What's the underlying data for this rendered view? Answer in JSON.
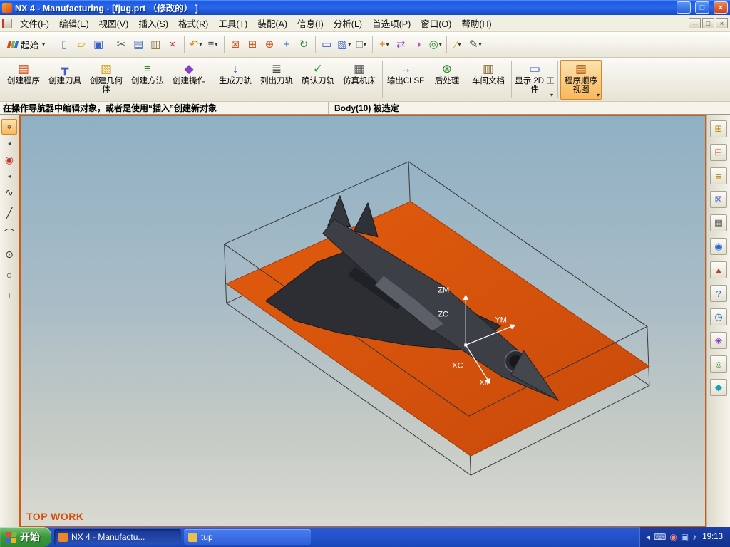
{
  "titlebar": {
    "title": "NX 4 - Manufacturing - [fjug.prt （修改的） ]",
    "min_glyph": "_",
    "restore_glyph": "□",
    "close_glyph": "×"
  },
  "menubar": {
    "items": [
      "文件(F)",
      "编辑(E)",
      "视图(V)",
      "插入(S)",
      "格式(R)",
      "工具(T)",
      "装配(A)",
      "信息(I)",
      "分析(L)",
      "首选项(P)",
      "窗口(O)",
      "帮助(H)"
    ],
    "mdi": {
      "min": "—",
      "restore": "□",
      "close": "×"
    }
  },
  "standard_toolbar": {
    "start_button": {
      "label": "起始",
      "caret": "▾"
    },
    "icons": [
      {
        "name": "new-file-icon",
        "g": "▯",
        "c": "#6b86b8"
      },
      {
        "name": "open-folder-icon",
        "g": "▱",
        "c": "#d9a520"
      },
      {
        "name": "save-icon",
        "g": "▣",
        "c": "#3a5fcd"
      },
      {
        "type": "sep"
      },
      {
        "name": "cut-icon",
        "g": "✂",
        "c": "#555555"
      },
      {
        "name": "copy-icon",
        "g": "▤",
        "c": "#4a72c4"
      },
      {
        "name": "paste-icon",
        "g": "▥",
        "c": "#8a6d3b"
      },
      {
        "name": "delete-icon",
        "g": "×",
        "c": "#cc2222"
      },
      {
        "type": "sep"
      },
      {
        "name": "undo-icon",
        "g": "↶",
        "c": "#e07b00",
        "caret": "▾"
      },
      {
        "name": "repeat-command-icon",
        "g": "≡",
        "c": "#555555",
        "caret": "▾"
      },
      {
        "type": "sep"
      },
      {
        "name": "fit-view-icon",
        "g": "⊠",
        "c": "#d9531e"
      },
      {
        "name": "zoom-window-icon",
        "g": "⊞",
        "c": "#d9531e"
      },
      {
        "name": "zoom-icon",
        "g": "⊕",
        "c": "#d9531e"
      },
      {
        "name": "pan-icon",
        "g": "+",
        "c": "#3a5fcd"
      },
      {
        "name": "rotate-view-icon",
        "g": "↻",
        "c": "#2e8b2e"
      },
      {
        "type": "sep"
      },
      {
        "name": "snapshot-icon",
        "g": "▭",
        "c": "#3a5fcd"
      },
      {
        "name": "shaded-view-icon",
        "g": "▧",
        "c": "#3a5fcd",
        "caret": "▾"
      },
      {
        "name": "render-style-icon",
        "g": "□",
        "c": "#707070",
        "caret": "▾"
      },
      {
        "type": "sep"
      },
      {
        "name": "wcs-dynamics-icon",
        "g": "+",
        "c": "#e07b00",
        "caret": "▾"
      },
      {
        "name": "transform-icon",
        "g": "⇄",
        "c": "#8a40c8"
      },
      {
        "name": "edit-object-display-icon",
        "g": "◑",
        "c": "#b05ac4"
      },
      {
        "name": "show-hide-icon",
        "g": "◎",
        "c": "#2e8b2e",
        "caret": "▾"
      },
      {
        "type": "sep"
      },
      {
        "name": "measure-distance-icon",
        "g": "∕",
        "c": "#d9a520",
        "caret": "▾"
      },
      {
        "name": "annotation-pencil-icon",
        "g": "✎",
        "c": "#555555",
        "caret": "▾"
      }
    ]
  },
  "mfg_toolbar": {
    "buttons": [
      {
        "name": "create-program-button",
        "label": "创建程序",
        "g": "▤",
        "c": "#d9531e"
      },
      {
        "name": "create-tool-button",
        "label": "创建刀具",
        "g": "┳",
        "c": "#3a5fcd"
      },
      {
        "name": "create-geometry-button",
        "label": "创建几何体",
        "g": "▧",
        "c": "#d9a41e"
      },
      {
        "name": "create-method-button",
        "label": "创建方法",
        "g": "≡",
        "c": "#2e8b2e"
      },
      {
        "name": "create-operation-button",
        "label": "创建操作",
        "g": "◆",
        "c": "#8a40c8"
      },
      {
        "type": "sep"
      },
      {
        "name": "generate-toolpath-button",
        "label": "生成刀轨",
        "g": "↓",
        "c": "#2255cc"
      },
      {
        "name": "list-toolpath-button",
        "label": "列出刀轨",
        "g": "≣",
        "c": "#444444"
      },
      {
        "name": "verify-toolpath-button",
        "label": "确认刀轨",
        "g": "✓",
        "c": "#22a022"
      },
      {
        "name": "simulate-machine-button",
        "label": "仿真机床",
        "g": "▦",
        "c": "#666666"
      },
      {
        "type": "sep"
      },
      {
        "name": "output-clsf-button",
        "label": "输出CLSF",
        "g": "→",
        "c": "#2255cc"
      },
      {
        "name": "postprocess-button",
        "label": "后处理",
        "g": "⊛",
        "c": "#2e8b2e"
      },
      {
        "name": "shop-documents-button",
        "label": "车间文档",
        "g": "▥",
        "c": "#8a6d3b"
      },
      {
        "type": "sep"
      },
      {
        "name": "show-2d-workpiece-button",
        "label": "显示 2D 工件",
        "g": "▭",
        "c": "#2255cc",
        "caret": "▾"
      },
      {
        "type": "sep"
      },
      {
        "name": "program-order-view-button",
        "label": "程序顺序视图",
        "g": "▤",
        "c": "#b35a10",
        "caret": "▾",
        "active": true
      }
    ]
  },
  "prompt": {
    "message": "在操作导航器中编辑对象，或者是使用“插入”创建新对象",
    "status": "Body(10) 被选定"
  },
  "left_rail": {
    "icons": [
      {
        "name": "snap-point-icon",
        "g": "⌖",
        "c": "#222222",
        "active": true
      },
      {
        "name": "expand-chevron-icon",
        "g": "◂",
        "c": "#444444",
        "cls": "small"
      },
      {
        "name": "feature-tool-icon",
        "g": "◉",
        "c": "#c0392b"
      },
      {
        "name": "expand-chevron-icon",
        "g": "◂",
        "c": "#444444",
        "cls": "small"
      },
      {
        "name": "spline-icon",
        "g": "∿",
        "c": "#333333"
      },
      {
        "name": "line-icon",
        "g": "╱",
        "c": "#333333"
      },
      {
        "name": "arc-icon",
        "g": "⌒",
        "c": "#333333"
      },
      {
        "name": "circle-center-icon",
        "g": "⊙",
        "c": "#333333"
      },
      {
        "name": "circle-icon",
        "g": "○",
        "c": "#333333"
      },
      {
        "name": "point-icon",
        "g": "+",
        "c": "#333333"
      }
    ]
  },
  "right_rail": {
    "icons": [
      {
        "name": "assembly-navigator-icon",
        "g": "⊞",
        "c": "#b8860b"
      },
      {
        "name": "constraint-navigator-icon",
        "g": "⊟",
        "c": "#c0392b"
      },
      {
        "name": "part-navigator-icon",
        "g": "≡",
        "c": "#b8860b"
      },
      {
        "name": "operation-navigator-icon",
        "g": "⊠",
        "c": "#3a5fcd"
      },
      {
        "name": "machine-navigator-icon",
        "g": "▦",
        "c": "#666666"
      },
      {
        "name": "web-browser-icon",
        "g": "◉",
        "c": "#2a6fd4"
      },
      {
        "name": "reuse-library-icon",
        "g": "▲",
        "c": "#c0392b"
      },
      {
        "name": "help-icon",
        "g": "?",
        "c": "#2a6fd4"
      },
      {
        "name": "history-icon",
        "g": "◷",
        "c": "#2a6fd4"
      },
      {
        "name": "process-studio-icon",
        "g": "◈",
        "c": "#8a40c8"
      },
      {
        "name": "roles-icon",
        "g": "☺",
        "c": "#2e8b2e"
      },
      {
        "name": "system-scene-icon",
        "g": "◆",
        "c": "#17a2b8"
      }
    ]
  },
  "viewport": {
    "view_label": "TOP WORK",
    "axes": {
      "zm": "ZM",
      "zc": "ZC",
      "ym": "YM",
      "xc": "XC",
      "xm": "XM"
    }
  },
  "taskbar": {
    "start_label": "开始",
    "tasks": [
      {
        "name": "taskbar-item-nx",
        "label": "NX 4 - Manufactu...",
        "ic": "#e8882a",
        "active": true
      },
      {
        "name": "taskbar-item-tup",
        "label": "tup",
        "ic": "#e9c04f"
      }
    ],
    "tray_icons": [
      {
        "name": "tray-collapse-icon",
        "g": "◂",
        "c": "#d6e4ff"
      },
      {
        "name": "keyboard-icon",
        "g": "⌨",
        "c": "#d6e4ff"
      },
      {
        "name": "antivirus-icon",
        "g": "◉",
        "c": "#ff8a7a"
      },
      {
        "name": "input-language-icon",
        "g": "▣",
        "c": "#a8c8ff"
      },
      {
        "name": "volume-icon",
        "g": "♪",
        "c": "#d6e4ff"
      }
    ],
    "clock": "19:13"
  }
}
